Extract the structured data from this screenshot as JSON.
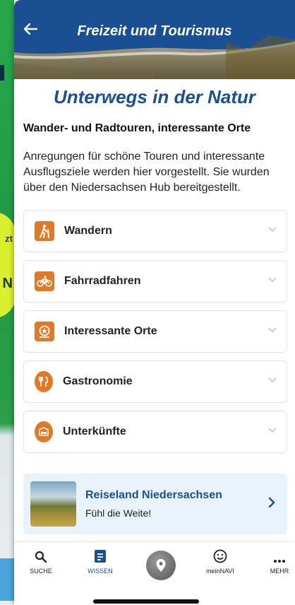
{
  "header": {
    "title": "Freizeit und Tourismus"
  },
  "page": {
    "heading": "Unterwegs in der Natur",
    "subheading": "Wander- und Radtouren, interessante Orte",
    "description": "Anregungen für schöne Touren und interessante Ausflugsziele werden hier vorgestellt. Sie wurden über den Niedersachsen Hub bereitgestellt."
  },
  "categories": [
    {
      "label": "Wandern",
      "icon": "hiking-icon"
    },
    {
      "label": "Fahrradfahren",
      "icon": "bicycle-icon"
    },
    {
      "label": "Interessante Orte",
      "icon": "star-sign-icon"
    },
    {
      "label": "Gastronomie",
      "icon": "cutlery-pin-icon"
    },
    {
      "label": "Unterkünfte",
      "icon": "bed-pin-icon"
    }
  ],
  "promo": {
    "title": "Reiseland Niedersachsen",
    "subtitle": "Fühl die Weite!"
  },
  "nav": {
    "items": [
      {
        "label": "SUCHE",
        "icon": "search-icon"
      },
      {
        "label": "WISSEN",
        "icon": "document-icon"
      },
      {
        "label": "",
        "icon": "location-pin-icon"
      },
      {
        "label": "meinNAVI",
        "icon": "smiley-icon"
      },
      {
        "label": "MEHR",
        "icon": "more-dots-icon"
      }
    ]
  },
  "background": {
    "badge_line1": "zt",
    "badge_line2": "N"
  },
  "colors": {
    "brand_blue": "#1a4f93",
    "accent_orange": "#e07a28",
    "promo_bg": "#e9f3fb"
  }
}
